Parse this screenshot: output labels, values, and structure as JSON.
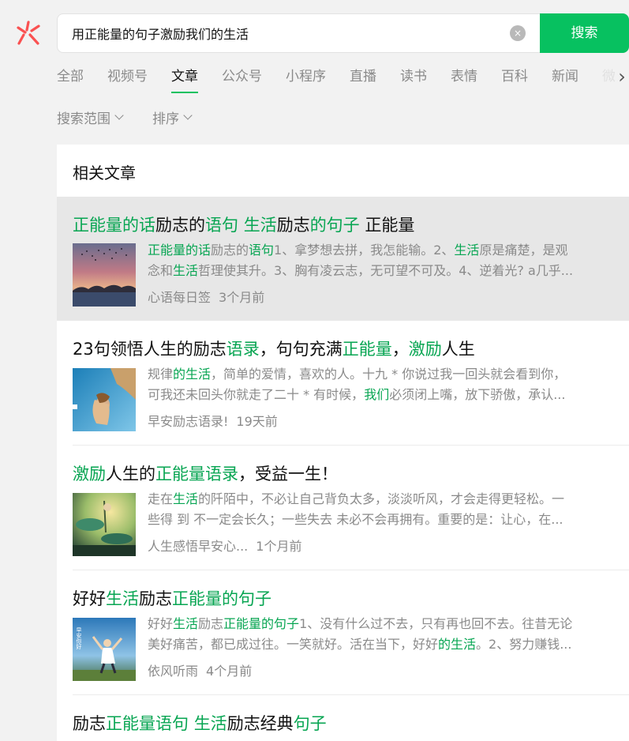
{
  "search": {
    "query": "用正能量的句子激励我们的生活",
    "button_label": "搜索",
    "clear_glyph": "×"
  },
  "tabs": [
    {
      "label": "全部"
    },
    {
      "label": "视频号"
    },
    {
      "label": "文章"
    },
    {
      "label": "公众号"
    },
    {
      "label": "小程序"
    },
    {
      "label": "直播"
    },
    {
      "label": "读书"
    },
    {
      "label": "表情"
    },
    {
      "label": "百科"
    },
    {
      "label": "新闻"
    },
    {
      "label": "微"
    }
  ],
  "active_tab": "文章",
  "filters": {
    "scope": "搜索范围",
    "sort": "排序"
  },
  "section_title": "相关文章",
  "results": [
    {
      "title": [
        {
          "t": "正能量的话",
          "g": true
        },
        {
          "t": "励志的",
          "g": false
        },
        {
          "t": "语句",
          "g": true
        },
        {
          "t": " ",
          "g": false
        },
        {
          "t": "生活",
          "g": true
        },
        {
          "t": "励志",
          "g": false
        },
        {
          "t": "的句子",
          "g": true
        },
        {
          "t": " 正能量",
          "g": false
        }
      ],
      "snippet_line1": [
        {
          "t": "正能量的话",
          "g": true
        },
        {
          "t": "励志的",
          "g": false
        },
        {
          "t": "语句",
          "g": true
        },
        {
          "t": "1、拿梦想去拼，我怎能输。2、",
          "g": false
        },
        {
          "t": "生活",
          "g": true
        },
        {
          "t": "原是痛楚，是观",
          "g": false
        }
      ],
      "snippet_line2": [
        {
          "t": "念和",
          "g": false
        },
        {
          "t": "生活",
          "g": true
        },
        {
          "t": "哲理使其升。3、胸有凌云志，无可望不可及。4、逆着光? a几乎...",
          "g": false
        }
      ],
      "source": "心语每日签",
      "time": "3个月前"
    },
    {
      "title": [
        {
          "t": "23句领悟人生的励志",
          "g": false
        },
        {
          "t": "语录",
          "g": true
        },
        {
          "t": "，句句充满",
          "g": false
        },
        {
          "t": "正能量",
          "g": true
        },
        {
          "t": "，",
          "g": false
        },
        {
          "t": "激励",
          "g": true
        },
        {
          "t": "人生",
          "g": false
        }
      ],
      "snippet_line1": [
        {
          "t": "规律",
          "g": false
        },
        {
          "t": "的生活",
          "g": true
        },
        {
          "t": "，简单的爱情，喜欢的人。十九 * 你说过我一回头就会看到你，",
          "g": false
        }
      ],
      "snippet_line2": [
        {
          "t": "可我还未回头你就走了二十 * 有时候，",
          "g": false
        },
        {
          "t": "我们",
          "g": true
        },
        {
          "t": "必须闭上嘴，放下骄傲，承认...",
          "g": false
        }
      ],
      "source": "早安励志语录!",
      "time": "19天前"
    },
    {
      "title": [
        {
          "t": "激励",
          "g": true
        },
        {
          "t": "人生的",
          "g": false
        },
        {
          "t": "正能量语录",
          "g": true
        },
        {
          "t": "，受益一生！",
          "g": false
        }
      ],
      "snippet_line1": [
        {
          "t": "走在",
          "g": false
        },
        {
          "t": "生活",
          "g": true
        },
        {
          "t": "的阡陌中，不必让自己背负太多，淡淡听风，才会走得更轻松。一",
          "g": false
        }
      ],
      "snippet_line2": [
        {
          "t": "些得 到 不一定会长久；一些失去 未必不会再拥有。重要的是：让心，在...",
          "g": false
        }
      ],
      "source": "人生感悟早安心...",
      "time": "1个月前"
    },
    {
      "title": [
        {
          "t": "好好",
          "g": false
        },
        {
          "t": "生活",
          "g": true
        },
        {
          "t": "励志",
          "g": false
        },
        {
          "t": "正能量的句子",
          "g": true
        }
      ],
      "snippet_line1": [
        {
          "t": "好好",
          "g": false
        },
        {
          "t": "生活",
          "g": true
        },
        {
          "t": "励志",
          "g": false
        },
        {
          "t": "正能量的句子",
          "g": true
        },
        {
          "t": "1、没有什么过不去，只有再也回不去。往昔无论",
          "g": false
        }
      ],
      "snippet_line2": [
        {
          "t": "美好痛苦，都已成过往。一笑就好。活在当下，好好",
          "g": false
        },
        {
          "t": "的生活",
          "g": true
        },
        {
          "t": "。2、努力赚钱...",
          "g": false
        }
      ],
      "thumb_text": "早安你好",
      "source": "依风听雨",
      "time": "4个月前"
    },
    {
      "title": [
        {
          "t": "励志",
          "g": false
        },
        {
          "t": "正能量语句",
          "g": true
        },
        {
          "t": " ",
          "g": false
        },
        {
          "t": "生活",
          "g": true
        },
        {
          "t": "励志经典",
          "g": false
        },
        {
          "t": "句子",
          "g": true
        }
      ]
    }
  ],
  "colors": {
    "accent": "#07c160",
    "highlight_text": "#07a552",
    "muted_text": "#8a8a8a",
    "hover_bg": "#e7e7e7"
  },
  "icons": {
    "logo": "weixin-search-logo-icon",
    "clear": "clear-icon",
    "more_tabs": "chevron-right-icon",
    "dropdown": "chevron-down-icon"
  }
}
